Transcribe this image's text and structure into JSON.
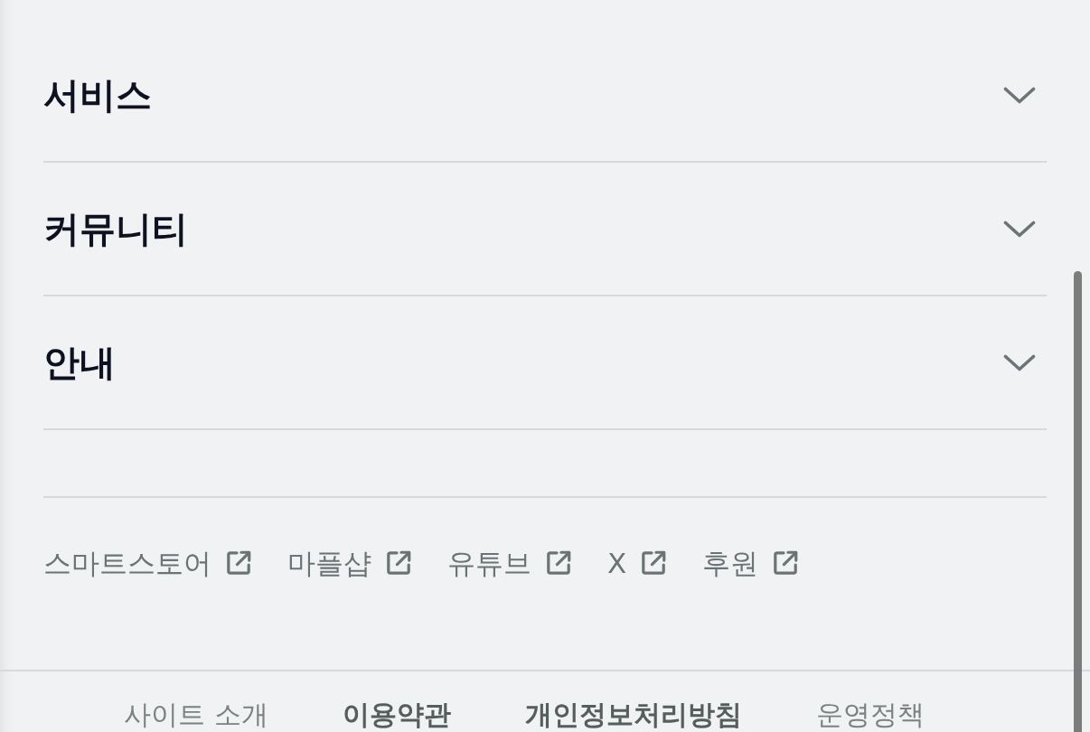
{
  "sections": [
    {
      "title": "서비스",
      "expanded": false
    },
    {
      "title": "커뮤니티",
      "expanded": false
    },
    {
      "title": "안내",
      "expanded": false
    }
  ],
  "external_links": [
    {
      "label": "스마트스토어"
    },
    {
      "label": "마플샵"
    },
    {
      "label": "유튜브"
    },
    {
      "label": "X"
    },
    {
      "label": "후원"
    }
  ],
  "footer_links": [
    {
      "label": "사이트 소개",
      "bold": false
    },
    {
      "label": "이용약관",
      "bold": true
    },
    {
      "label": "개인정보처리방침",
      "bold": true
    },
    {
      "label": "운영정책",
      "bold": false
    }
  ]
}
